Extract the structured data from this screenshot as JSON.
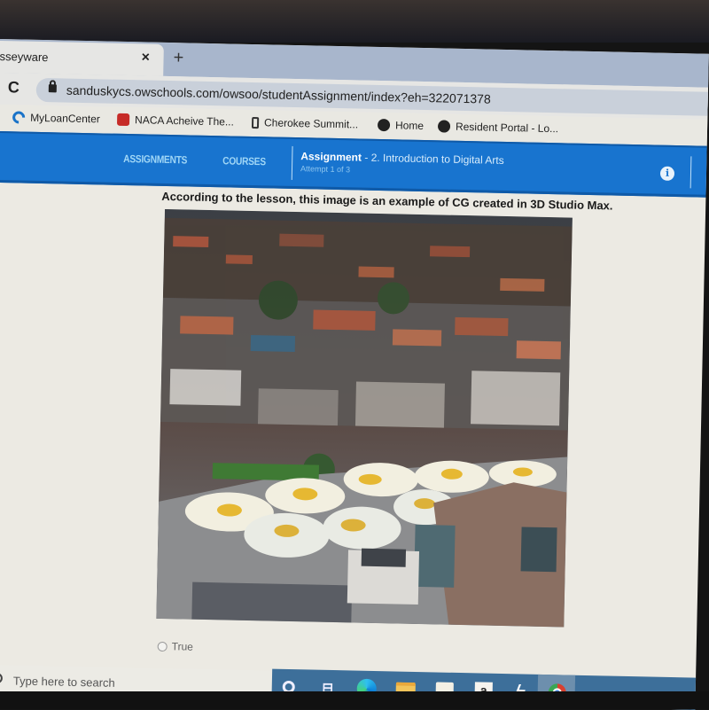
{
  "browser": {
    "tab_title": "sseyware",
    "tab_close": "×",
    "new_tab": "+",
    "reload": "C",
    "url": "sanduskycs.owschools.com/owsoo/studentAssignment/index?eh=322071378"
  },
  "bookmarks": [
    {
      "label": "MyLoanCenter",
      "icon": "myloancenter-icon"
    },
    {
      "label": "NACA Acheive The...",
      "icon": "naca-house-icon"
    },
    {
      "label": "Cherokee Summit...",
      "icon": "bottle-icon"
    },
    {
      "label": "Home",
      "icon": "globe-icon"
    },
    {
      "label": "Resident Portal - Lo...",
      "icon": "globe-icon"
    }
  ],
  "nav": {
    "assignments": "ASSIGNMENTS",
    "courses": "COURSES",
    "assignment_label": "Assignment",
    "assignment_name": "- 2. Introduction to Digital Arts",
    "attempt": "Attempt 1 of 3",
    "info": "i"
  },
  "question": {
    "text": "According to the lesson, this image is an example of CG created in 3D Studio Max.",
    "image_alt": "Aerial photo of a town square painted with giant fried eggs",
    "options": [
      {
        "label": "True",
        "selected": false
      }
    ]
  },
  "taskbar": {
    "search_placeholder": "Type here to search",
    "amazon_glyph": "a",
    "bolt_glyph": "⚡",
    "apps": [
      "cortana",
      "task-view",
      "edge",
      "file-explorer",
      "store",
      "amazon",
      "app-bolt",
      "chrome"
    ]
  },
  "colors": {
    "nav_blue": "#1874cf",
    "nav_link": "#9fd6f6",
    "taskbar": "#3d6f9a"
  }
}
